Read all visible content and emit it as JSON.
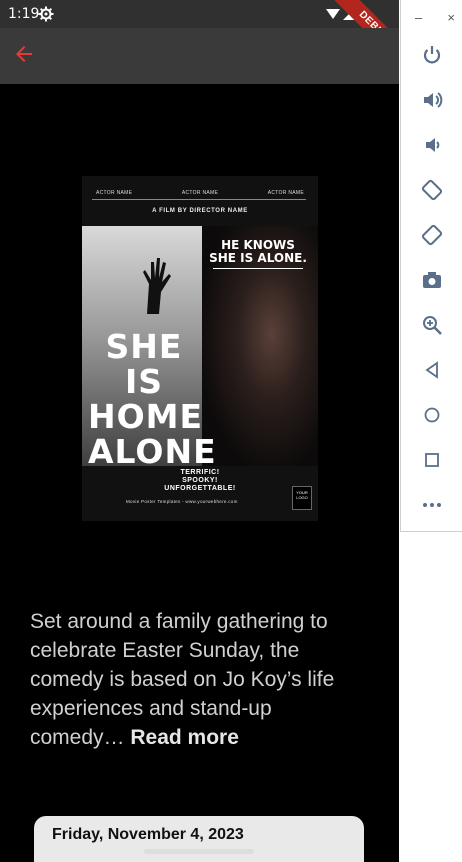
{
  "status_bar": {
    "time": "1:19",
    "debug_label": "DEBUG"
  },
  "app_bar": {
    "back_icon": "arrow-back-icon",
    "accent_color": "#e53935"
  },
  "poster": {
    "actors": [
      "ACTOR NAME",
      "ACTOR NAME",
      "ACTOR NAME"
    ],
    "film_by": "A FILM BY DIRECTOR NAME",
    "he_knows_1": "HE KNOWS",
    "he_knows_2": "SHE IS ALONE.",
    "title_1": "SHE IS",
    "title_2": "HOME",
    "title_3": "ALONE",
    "tagline_1": "TERRIFIC!",
    "tagline_2": "SPOOKY!",
    "tagline_3": "UNFORGETTABLE!",
    "credits": "Movie Poster Templates - www.yourwebhere.com",
    "logo_1": "YOUR",
    "logo_2": "LOGO"
  },
  "description": {
    "text": "Set around a family gathering to celebrate Easter Sunday, the comedy is based on Jo Koy’s life experiences and stand-up comedy…",
    "read_more": "Read more"
  },
  "date_card": {
    "date": "Friday, November 4, 2023"
  },
  "emulator_toolbar": {
    "minimize": "–",
    "close": "×",
    "tools": [
      "power-icon",
      "volume-up-icon",
      "volume-down-icon",
      "rotate-left-icon",
      "rotate-right-icon",
      "camera-icon",
      "zoom-in-icon",
      "back-icon",
      "home-icon",
      "overview-icon",
      "more-icon"
    ],
    "icon_color": "#5b6f8a"
  }
}
